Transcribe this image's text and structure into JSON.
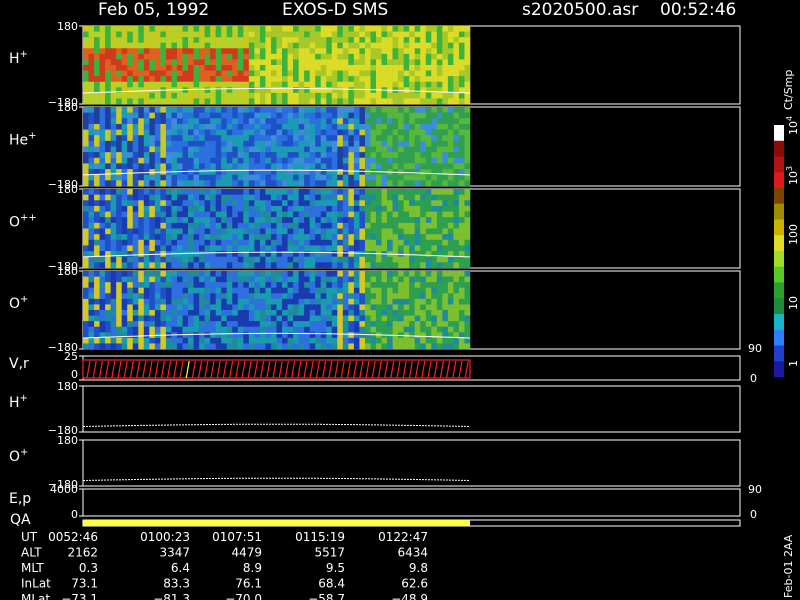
{
  "header": {
    "date": "Feb 05, 1992",
    "instrument": "EXOS-D SMS",
    "file": "s2020500.asr",
    "time": "00:52:46"
  },
  "colorbar": {
    "unit_label": "Ct/Smp",
    "ticks": [
      "1",
      "10",
      "100",
      "10^3",
      "10^4"
    ],
    "colors": [
      "#1a1aa0",
      "#2040d0",
      "#2f80ff",
      "#19b4c8",
      "#1e8c3c",
      "#2ca02c",
      "#58c82a",
      "#a0dc28",
      "#dcdc28",
      "#c8b400",
      "#a08c00",
      "#784600",
      "#e01a1a",
      "#b01414",
      "#8c0a0a",
      "#ffffff"
    ]
  },
  "side_note": "Feb-01 2AA",
  "chart_data": [
    {
      "type": "heatmap",
      "panel": "H+",
      "ylabel": "H+",
      "yticks": [
        "180",
        "−180"
      ],
      "ylim": [
        -180,
        180
      ],
      "dominant_colors": [
        "#e03020",
        "#c0c020",
        "#40c040"
      ],
      "overlay_trace": "white"
    },
    {
      "type": "heatmap",
      "panel": "He+",
      "ylabel": "He+",
      "yticks": [
        "180",
        "−180"
      ],
      "ylim": [
        -180,
        180
      ],
      "dominant_colors": [
        "#3070e0",
        "#20a0a0",
        "#40b040"
      ],
      "overlay_trace": "white"
    },
    {
      "type": "heatmap",
      "panel": "O++",
      "ylabel": "O++",
      "yticks": [
        "180",
        "−180"
      ],
      "ylim": [
        -180,
        180
      ],
      "dominant_colors": [
        "#2050d0",
        "#20a0a0",
        "#50b040"
      ],
      "overlay_trace": "white"
    },
    {
      "type": "heatmap",
      "panel": "O+",
      "ylabel": "O+",
      "yticks": [
        "180",
        "−180"
      ],
      "ylim": [
        -180,
        180
      ],
      "dominant_colors": [
        "#2050d0",
        "#20a0a0",
        "#50b040"
      ],
      "overlay_trace": "white"
    },
    {
      "type": "line",
      "panel": "V,r",
      "ylabel": "V,r",
      "yticks": [
        "25",
        "0"
      ],
      "ylim": [
        0,
        25
      ],
      "right_ticks": [
        "90",
        "0"
      ],
      "color": "#ff2020"
    },
    {
      "type": "line",
      "panel": "H+ (line)",
      "ylabel": "H+",
      "yticks": [
        "180",
        "−180"
      ],
      "ylim": [
        -180,
        180
      ]
    },
    {
      "type": "line",
      "panel": "O+ (line)",
      "ylabel": "O+",
      "yticks": [
        "180",
        "−180"
      ],
      "ylim": [
        -180,
        180
      ]
    },
    {
      "type": "line",
      "panel": "E,p",
      "ylabel": "E,p",
      "yticks": [
        "4000",
        "0"
      ],
      "right_ticks": [
        "90",
        "0"
      ]
    },
    {
      "type": "bar",
      "panel": "QA",
      "ylabel": "QA",
      "color": "#ffff40"
    }
  ],
  "ephemeris": {
    "rows": [
      {
        "label": "UT",
        "values": [
          "0052:46",
          "0100:23",
          "0107:51",
          "0115:19",
          "0122:47"
        ]
      },
      {
        "label": "ALT",
        "values": [
          "2162",
          "3347",
          "4479",
          "5517",
          "6434"
        ]
      },
      {
        "label": "MLT",
        "values": [
          "0.3",
          "6.4",
          "8.9",
          "9.5",
          "9.8"
        ]
      },
      {
        "label": "InLat",
        "values": [
          "73.1",
          "83.3",
          "76.1",
          "68.4",
          "62.6"
        ]
      },
      {
        "label": "MLat",
        "values": [
          "−73.1",
          "−81.3",
          "−70.0",
          "−58.7",
          "−48.9"
        ]
      }
    ]
  }
}
